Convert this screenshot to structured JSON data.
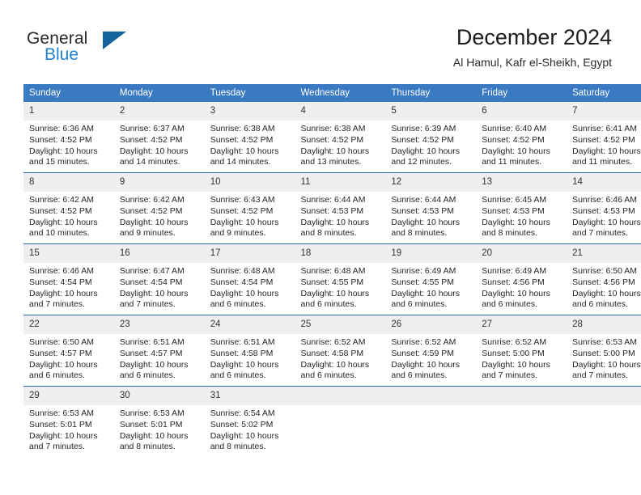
{
  "brand": {
    "name_part1": "General",
    "name_part2": "Blue",
    "logo_icon": "triangle-logo-icon"
  },
  "header": {
    "title": "December 2024",
    "subtitle": "Al Hamul, Kafr el-Sheikh, Egypt"
  },
  "colors": {
    "header_blue": "#3a7ac2",
    "row_divider_blue": "#2f6fb5",
    "daynum_band": "#efefef",
    "brand_blue": "#1f7fd0",
    "logo_blue": "#14639e"
  },
  "weekdays": [
    "Sunday",
    "Monday",
    "Tuesday",
    "Wednesday",
    "Thursday",
    "Friday",
    "Saturday"
  ],
  "weeks": [
    [
      {
        "day": "1",
        "sunrise": "Sunrise: 6:36 AM",
        "sunset": "Sunset: 4:52 PM",
        "daylight1": "Daylight: 10 hours",
        "daylight2": "and 15 minutes."
      },
      {
        "day": "2",
        "sunrise": "Sunrise: 6:37 AM",
        "sunset": "Sunset: 4:52 PM",
        "daylight1": "Daylight: 10 hours",
        "daylight2": "and 14 minutes."
      },
      {
        "day": "3",
        "sunrise": "Sunrise: 6:38 AM",
        "sunset": "Sunset: 4:52 PM",
        "daylight1": "Daylight: 10 hours",
        "daylight2": "and 14 minutes."
      },
      {
        "day": "4",
        "sunrise": "Sunrise: 6:38 AM",
        "sunset": "Sunset: 4:52 PM",
        "daylight1": "Daylight: 10 hours",
        "daylight2": "and 13 minutes."
      },
      {
        "day": "5",
        "sunrise": "Sunrise: 6:39 AM",
        "sunset": "Sunset: 4:52 PM",
        "daylight1": "Daylight: 10 hours",
        "daylight2": "and 12 minutes."
      },
      {
        "day": "6",
        "sunrise": "Sunrise: 6:40 AM",
        "sunset": "Sunset: 4:52 PM",
        "daylight1": "Daylight: 10 hours",
        "daylight2": "and 11 minutes."
      },
      {
        "day": "7",
        "sunrise": "Sunrise: 6:41 AM",
        "sunset": "Sunset: 4:52 PM",
        "daylight1": "Daylight: 10 hours",
        "daylight2": "and 11 minutes."
      }
    ],
    [
      {
        "day": "8",
        "sunrise": "Sunrise: 6:42 AM",
        "sunset": "Sunset: 4:52 PM",
        "daylight1": "Daylight: 10 hours",
        "daylight2": "and 10 minutes."
      },
      {
        "day": "9",
        "sunrise": "Sunrise: 6:42 AM",
        "sunset": "Sunset: 4:52 PM",
        "daylight1": "Daylight: 10 hours",
        "daylight2": "and 9 minutes."
      },
      {
        "day": "10",
        "sunrise": "Sunrise: 6:43 AM",
        "sunset": "Sunset: 4:52 PM",
        "daylight1": "Daylight: 10 hours",
        "daylight2": "and 9 minutes."
      },
      {
        "day": "11",
        "sunrise": "Sunrise: 6:44 AM",
        "sunset": "Sunset: 4:53 PM",
        "daylight1": "Daylight: 10 hours",
        "daylight2": "and 8 minutes."
      },
      {
        "day": "12",
        "sunrise": "Sunrise: 6:44 AM",
        "sunset": "Sunset: 4:53 PM",
        "daylight1": "Daylight: 10 hours",
        "daylight2": "and 8 minutes."
      },
      {
        "day": "13",
        "sunrise": "Sunrise: 6:45 AM",
        "sunset": "Sunset: 4:53 PM",
        "daylight1": "Daylight: 10 hours",
        "daylight2": "and 8 minutes."
      },
      {
        "day": "14",
        "sunrise": "Sunrise: 6:46 AM",
        "sunset": "Sunset: 4:53 PM",
        "daylight1": "Daylight: 10 hours",
        "daylight2": "and 7 minutes."
      }
    ],
    [
      {
        "day": "15",
        "sunrise": "Sunrise: 6:46 AM",
        "sunset": "Sunset: 4:54 PM",
        "daylight1": "Daylight: 10 hours",
        "daylight2": "and 7 minutes."
      },
      {
        "day": "16",
        "sunrise": "Sunrise: 6:47 AM",
        "sunset": "Sunset: 4:54 PM",
        "daylight1": "Daylight: 10 hours",
        "daylight2": "and 7 minutes."
      },
      {
        "day": "17",
        "sunrise": "Sunrise: 6:48 AM",
        "sunset": "Sunset: 4:54 PM",
        "daylight1": "Daylight: 10 hours",
        "daylight2": "and 6 minutes."
      },
      {
        "day": "18",
        "sunrise": "Sunrise: 6:48 AM",
        "sunset": "Sunset: 4:55 PM",
        "daylight1": "Daylight: 10 hours",
        "daylight2": "and 6 minutes."
      },
      {
        "day": "19",
        "sunrise": "Sunrise: 6:49 AM",
        "sunset": "Sunset: 4:55 PM",
        "daylight1": "Daylight: 10 hours",
        "daylight2": "and 6 minutes."
      },
      {
        "day": "20",
        "sunrise": "Sunrise: 6:49 AM",
        "sunset": "Sunset: 4:56 PM",
        "daylight1": "Daylight: 10 hours",
        "daylight2": "and 6 minutes."
      },
      {
        "day": "21",
        "sunrise": "Sunrise: 6:50 AM",
        "sunset": "Sunset: 4:56 PM",
        "daylight1": "Daylight: 10 hours",
        "daylight2": "and 6 minutes."
      }
    ],
    [
      {
        "day": "22",
        "sunrise": "Sunrise: 6:50 AM",
        "sunset": "Sunset: 4:57 PM",
        "daylight1": "Daylight: 10 hours",
        "daylight2": "and 6 minutes."
      },
      {
        "day": "23",
        "sunrise": "Sunrise: 6:51 AM",
        "sunset": "Sunset: 4:57 PM",
        "daylight1": "Daylight: 10 hours",
        "daylight2": "and 6 minutes."
      },
      {
        "day": "24",
        "sunrise": "Sunrise: 6:51 AM",
        "sunset": "Sunset: 4:58 PM",
        "daylight1": "Daylight: 10 hours",
        "daylight2": "and 6 minutes."
      },
      {
        "day": "25",
        "sunrise": "Sunrise: 6:52 AM",
        "sunset": "Sunset: 4:58 PM",
        "daylight1": "Daylight: 10 hours",
        "daylight2": "and 6 minutes."
      },
      {
        "day": "26",
        "sunrise": "Sunrise: 6:52 AM",
        "sunset": "Sunset: 4:59 PM",
        "daylight1": "Daylight: 10 hours",
        "daylight2": "and 6 minutes."
      },
      {
        "day": "27",
        "sunrise": "Sunrise: 6:52 AM",
        "sunset": "Sunset: 5:00 PM",
        "daylight1": "Daylight: 10 hours",
        "daylight2": "and 7 minutes."
      },
      {
        "day": "28",
        "sunrise": "Sunrise: 6:53 AM",
        "sunset": "Sunset: 5:00 PM",
        "daylight1": "Daylight: 10 hours",
        "daylight2": "and 7 minutes."
      }
    ],
    [
      {
        "day": "29",
        "sunrise": "Sunrise: 6:53 AM",
        "sunset": "Sunset: 5:01 PM",
        "daylight1": "Daylight: 10 hours",
        "daylight2": "and 7 minutes."
      },
      {
        "day": "30",
        "sunrise": "Sunrise: 6:53 AM",
        "sunset": "Sunset: 5:01 PM",
        "daylight1": "Daylight: 10 hours",
        "daylight2": "and 8 minutes."
      },
      {
        "day": "31",
        "sunrise": "Sunrise: 6:54 AM",
        "sunset": "Sunset: 5:02 PM",
        "daylight1": "Daylight: 10 hours",
        "daylight2": "and 8 minutes."
      },
      {
        "day": "",
        "sunrise": "",
        "sunset": "",
        "daylight1": "",
        "daylight2": ""
      },
      {
        "day": "",
        "sunrise": "",
        "sunset": "",
        "daylight1": "",
        "daylight2": ""
      },
      {
        "day": "",
        "sunrise": "",
        "sunset": "",
        "daylight1": "",
        "daylight2": ""
      },
      {
        "day": "",
        "sunrise": "",
        "sunset": "",
        "daylight1": "",
        "daylight2": ""
      }
    ]
  ]
}
